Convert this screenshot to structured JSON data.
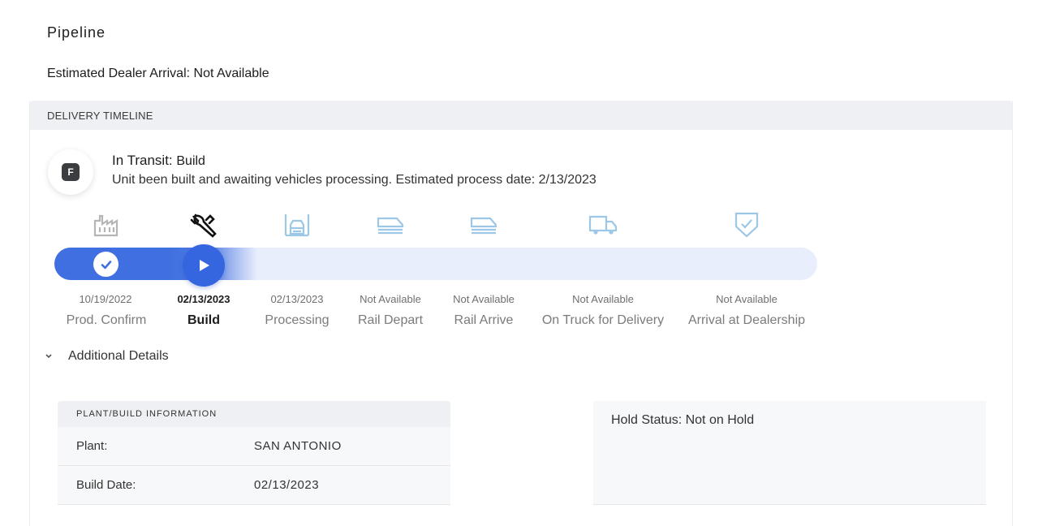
{
  "page": {
    "title": "Pipeline",
    "eta_label": "Estimated Dealer Arrival: Not Available"
  },
  "timeline": {
    "header": "DELIVERY TIMELINE",
    "avatar_letter": "F",
    "status_title": "In Transit:",
    "status_sub": "Build",
    "status_description": "Unit been built and awaiting vehicles processing. Estimated process date: 2/13/2023",
    "steps": [
      {
        "icon": "factory-icon",
        "date": "10/19/2022",
        "label": "Prod. Confirm",
        "state": "complete"
      },
      {
        "icon": "wrench-icon",
        "date": "02/13/2023",
        "label": "Build",
        "state": "active"
      },
      {
        "icon": "processing-icon",
        "date": "02/13/2023",
        "label": "Processing",
        "state": "pending"
      },
      {
        "icon": "rail-icon",
        "date": "Not Available",
        "label": "Rail Depart",
        "state": "pending"
      },
      {
        "icon": "rail-icon",
        "date": "Not Available",
        "label": "Rail Arrive",
        "state": "pending"
      },
      {
        "icon": "truck-icon",
        "date": "Not Available",
        "label": "On Truck for Delivery",
        "state": "pending"
      },
      {
        "icon": "shield-check-icon",
        "date": "Not Available",
        "label": "Arrival at Dealership",
        "state": "pending"
      }
    ],
    "colors": {
      "progress_fill": "#3f6fe0",
      "track": "#e9eefc",
      "pending_icon": "#9cc7e6",
      "complete_icon": "#b5b5b5"
    }
  },
  "details": {
    "toggle_label": "Additional Details",
    "plant_panel": {
      "header": "PLANT/BUILD INFORMATION",
      "rows": [
        {
          "key": "Plant:",
          "value": "SAN ANTONIO"
        },
        {
          "key": "Build Date:",
          "value": "02/13/2023"
        }
      ]
    },
    "hold_status": "Hold Status: Not on Hold"
  }
}
